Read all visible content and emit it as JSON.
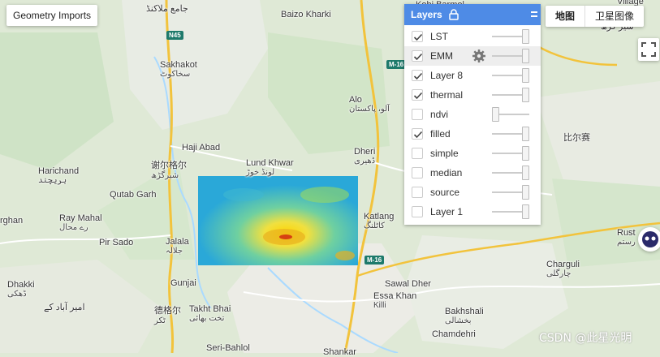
{
  "geometry_button": "Geometry Imports",
  "map_type": {
    "map": "地图",
    "satellite": "卫星图像"
  },
  "layers_panel": {
    "title": "Layers",
    "items": [
      {
        "name": "LST",
        "checked": true,
        "opacity": 1.0
      },
      {
        "name": "EMM",
        "checked": true,
        "opacity": 1.0
      },
      {
        "name": "Layer 8",
        "checked": true,
        "opacity": 1.0
      },
      {
        "name": "thermal",
        "checked": true,
        "opacity": 1.0
      },
      {
        "name": "ndvi",
        "checked": false,
        "opacity": 0.0
      },
      {
        "name": "filled",
        "checked": true,
        "opacity": 1.0
      },
      {
        "name": "simple",
        "checked": false,
        "opacity": 1.0
      },
      {
        "name": "median",
        "checked": false,
        "opacity": 1.0
      },
      {
        "name": "source",
        "checked": false,
        "opacity": 1.0
      },
      {
        "name": "Layer 1",
        "checked": false,
        "opacity": 1.0
      }
    ]
  },
  "places": {
    "kohi_barmol": "Kohi Barmol",
    "jamia": "جامع ملاكنڈ",
    "baizo": "Baizo Kharki",
    "sakhakot": "Sakhakot",
    "sakhakot_ur": "سخاکوٹ",
    "alo": "Alo",
    "alo_ur": "آلو، پاکستان",
    "haji_abad": "Haji Abad",
    "lund_khwar": "Lund Khwar",
    "lund_khwar_ur": "لونڈ خوڑ",
    "dheri": "Dheri",
    "dheri_ur": "ڈھیری",
    "xie_er_ge_er": "谢尔格尔",
    "xie_er_ge_er_ur": "شیرگڑھ",
    "harichand": "Harichand",
    "harichand_ur": "ہریچند",
    "qutab_garh": "Qutab Garh",
    "katlang": "Katlang",
    "katlang_ur": "کاٹلنگ",
    "ray_mahal": "Ray Mahal",
    "ray_mahal_ur": "رے محال",
    "rghan": "rghan",
    "pir_sado": "Pir Sado",
    "jalala": "Jalala",
    "jalala_ur": "جلالہ",
    "gunjai": "Gunjai",
    "dhakki": "Dhakki",
    "dhakki_ur": "ڈھکی",
    "amir_abad": "امیر آباد کے",
    "de_ge_er": "德格尔",
    "de_ge_er_ur": "ٹکر",
    "takht_bhai": "Takht Bhai",
    "takht_bhai_ur": "تخت بھائی",
    "sawal_dher": "Sawal Dher",
    "essa_khan": "Essa Khan",
    "killi": "Killi",
    "bakhshali": "Bakhshali",
    "bakhshali_ur": "بخشالی",
    "charguli": "Charguli",
    "charguli_ur": "چارگلی",
    "chamdehri": "Chamdehri",
    "seri_bahlol": "Seri-Bahlol",
    "shankar": "Shankar",
    "bi_er_sai": "比尔赛",
    "rust": "Rust",
    "rust_ur": "رستم",
    "sher_garh_top": "شیر گڑھ",
    "village": "Village",
    "m16_a": "M-16",
    "m16_b": "M-16",
    "n45": "N45"
  },
  "watermark": "CSDN @此星光明",
  "colors": {
    "panel_header": "#4e8be6",
    "road": "#f2c33c",
    "water": "#aadaff"
  }
}
